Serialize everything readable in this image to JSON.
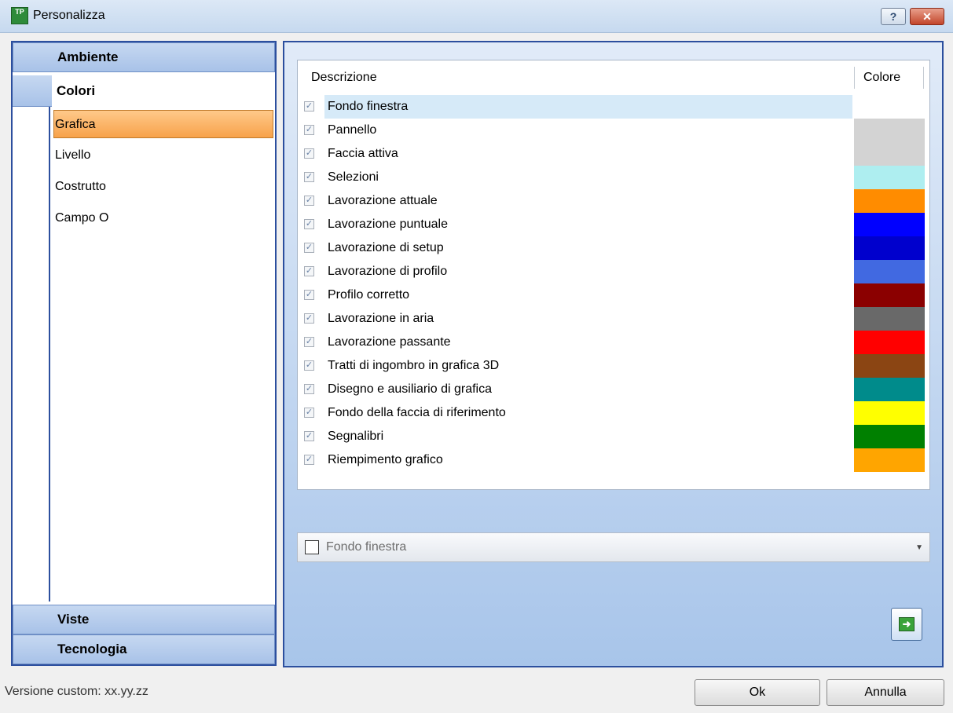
{
  "window": {
    "title": "Personalizza",
    "help_label": "?",
    "close_label": "✕",
    "app_icon_label": "TP"
  },
  "sidebar": {
    "sections": [
      {
        "label": "Ambiente"
      },
      {
        "label": "Colori"
      },
      {
        "label": "Viste"
      },
      {
        "label": "Tecnologia"
      }
    ],
    "subitems": [
      {
        "label": "Grafica",
        "selected": true
      },
      {
        "label": "Livello"
      },
      {
        "label": "Costrutto"
      },
      {
        "label": "Campo O"
      }
    ]
  },
  "table": {
    "columns": {
      "description": "Descrizione",
      "color": "Colore"
    },
    "rows": [
      {
        "label": "Fondo finestra",
        "color": "#ffffff",
        "checked": true
      },
      {
        "label": "Pannello",
        "color": "#d3d3d3",
        "checked": true
      },
      {
        "label": "Faccia attiva",
        "color": "#d3d3d3",
        "checked": true
      },
      {
        "label": "Selezioni",
        "color": "#aeeef0",
        "checked": true
      },
      {
        "label": "Lavorazione attuale",
        "color": "#ff8c00",
        "checked": true
      },
      {
        "label": "Lavorazione puntuale",
        "color": "#0000ff",
        "checked": true
      },
      {
        "label": "Lavorazione di setup",
        "color": "#0000cd",
        "checked": true
      },
      {
        "label": "Lavorazione di profilo",
        "color": "#4169e1",
        "checked": true
      },
      {
        "label": "Profilo corretto",
        "color": "#8b0000",
        "checked": true
      },
      {
        "label": "Lavorazione in aria",
        "color": "#696969",
        "checked": true
      },
      {
        "label": "Lavorazione passante",
        "color": "#ff0000",
        "checked": true
      },
      {
        "label": "Tratti di ingombro in grafica 3D",
        "color": "#8b4513",
        "checked": true
      },
      {
        "label": "Disegno e ausiliario di grafica",
        "color": "#008b8b",
        "checked": true
      },
      {
        "label": "Fondo della faccia di riferimento",
        "color": "#ffff00",
        "checked": true
      },
      {
        "label": "Segnalibri",
        "color": "#008000",
        "checked": true
      },
      {
        "label": "Riempimento grafico",
        "color": "#ffa500",
        "checked": true
      }
    ]
  },
  "color_combo": {
    "value": "Fondo finestra",
    "swatch": "#ffffff"
  },
  "footer": {
    "version": "Versione custom: xx.yy.zz",
    "ok_label": "Ok",
    "cancel_label": "Annulla"
  }
}
